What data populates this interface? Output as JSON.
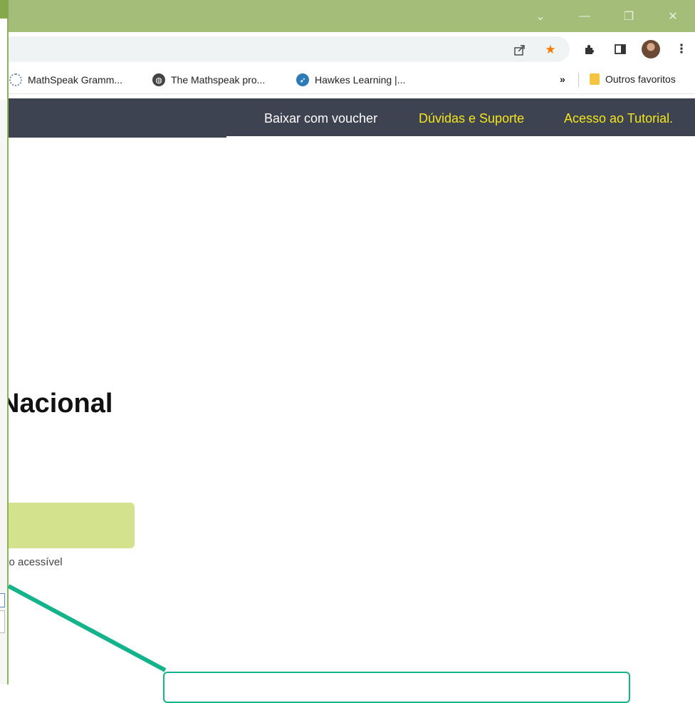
{
  "window": {
    "controls": [
      "⌄",
      "—",
      "❐",
      "✕"
    ]
  },
  "toolbar": {
    "icons": [
      "share-icon",
      "star-icon",
      "extensions-icon",
      "side-panel-icon",
      "profile-avatar",
      "menu-icon"
    ],
    "accent_star_color": "#f07c00"
  },
  "bookmarks": {
    "items": [
      {
        "label": "MathSpeak Gramm...",
        "icon": "mathspeak-icon"
      },
      {
        "label": "The Mathspeak pro...",
        "icon": "globe-icon"
      },
      {
        "label": "Hawkes Learning |...",
        "icon": "hawkes-icon"
      }
    ],
    "overflow": "»",
    "other_folder": "Outros favoritos"
  },
  "site_nav": {
    "items": [
      {
        "label": "Baixar com voucher",
        "color": "#ffffff"
      },
      {
        "label": "Dúvidas e Suporte",
        "color": "#f4e51b"
      },
      {
        "label": "Acesso ao Tutorial.",
        "color": "#f4e51b"
      }
    ],
    "background": "#3d4350"
  },
  "content": {
    "heading": "Nacional",
    "note": "ato acessível",
    "button_color": "#d2e28d"
  },
  "callout": {
    "border_color": "#14b38c"
  }
}
